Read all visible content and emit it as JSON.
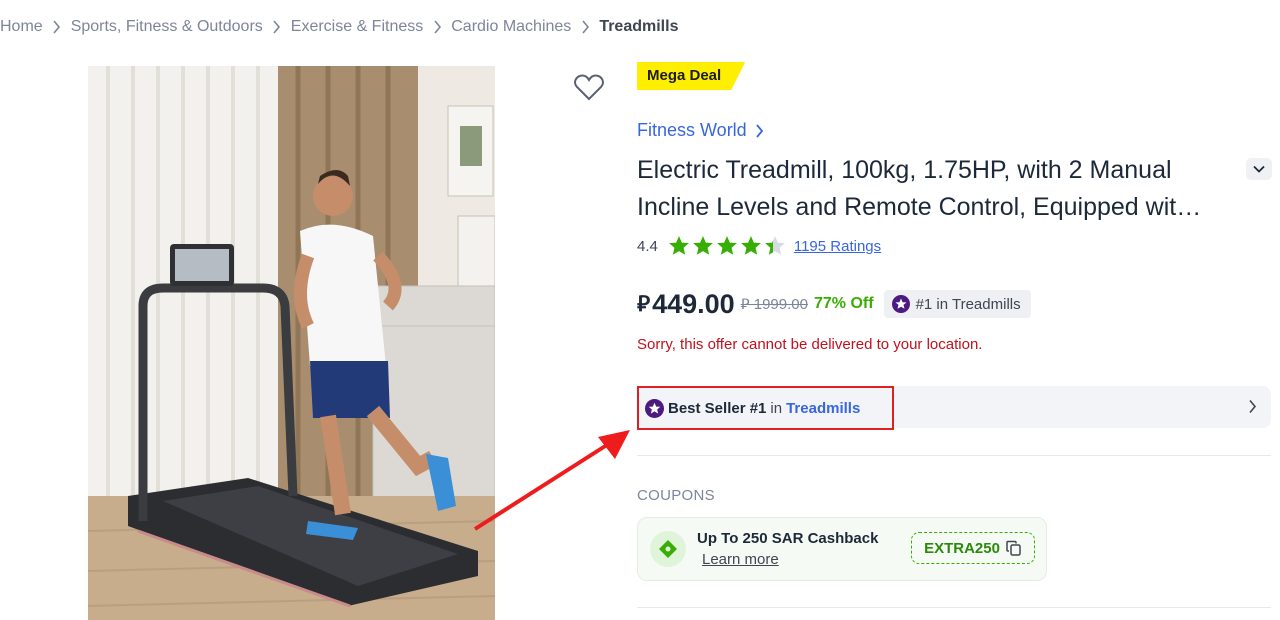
{
  "breadcrumb": {
    "items": [
      "Home",
      "Sports, Fitness & Outdoors",
      "Exercise & Fitness",
      "Cardio Machines",
      "Treadmills"
    ]
  },
  "product": {
    "badge": "Mega Deal",
    "brand": "Fitness World",
    "title_line1": "Electric Treadmill, 100kg, 1.75HP, with 2 Manual",
    "title_line2": "Incline Levels and Remote Control, Equipped wit…",
    "rating": "4.4",
    "stars_filled": 4.4,
    "ratings_count": "1195 Ratings",
    "currency_symbol": "⃁",
    "price": "449.00",
    "old_price": "⃁ 1999.00",
    "discount": "77% Off",
    "rank_badge": "#1 in Treadmills",
    "delivery_message": "Sorry, this offer cannot be delivered to your location."
  },
  "bestseller": {
    "label": "Best Seller #1",
    "in": "in",
    "category": "Treadmills"
  },
  "coupons": {
    "section_label": "COUPONS",
    "title": "Up To 250 SAR Cashback",
    "learn_more": "Learn more",
    "code": "EXTRA250"
  },
  "colors": {
    "accent_blue": "#3866df",
    "deal_yellow": "#feee00",
    "star_green": "#38ae04",
    "error_red": "#c3101c",
    "highlight_red": "#e02020"
  },
  "icons": {
    "wishlist": "heart-outline-icon",
    "brand_chevron": "chevron-right-icon",
    "expand": "chevron-down-icon",
    "rank": "star-badge-icon",
    "coupon": "ticket-icon",
    "copy": "copy-icon"
  }
}
